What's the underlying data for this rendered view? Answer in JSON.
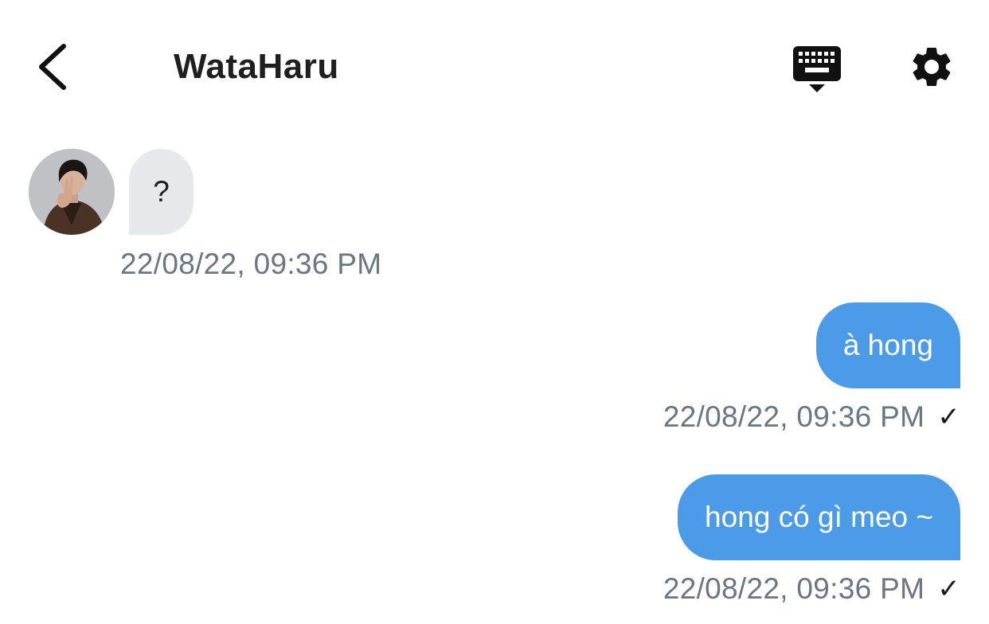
{
  "header": {
    "title": "WataHaru",
    "back_icon": "chevron-left-icon",
    "keyboard_icon": "keyboard-hide-icon",
    "settings_icon": "gear-icon"
  },
  "messages": [
    {
      "direction": "incoming",
      "text": "?",
      "timestamp": "22/08/22, 09:36 PM"
    },
    {
      "direction": "outgoing",
      "text": "à hong",
      "timestamp": "22/08/22, 09:36 PM",
      "status": "✓"
    },
    {
      "direction": "outgoing",
      "text": "hong có gì meo ~",
      "timestamp": "22/08/22, 09:36 PM",
      "status": "✓"
    }
  ],
  "colors": {
    "outgoing_bubble": "#4c9be8",
    "incoming_bubble": "#e6e8ec",
    "timestamp": "#6a7685",
    "title": "#1f1f1f"
  }
}
